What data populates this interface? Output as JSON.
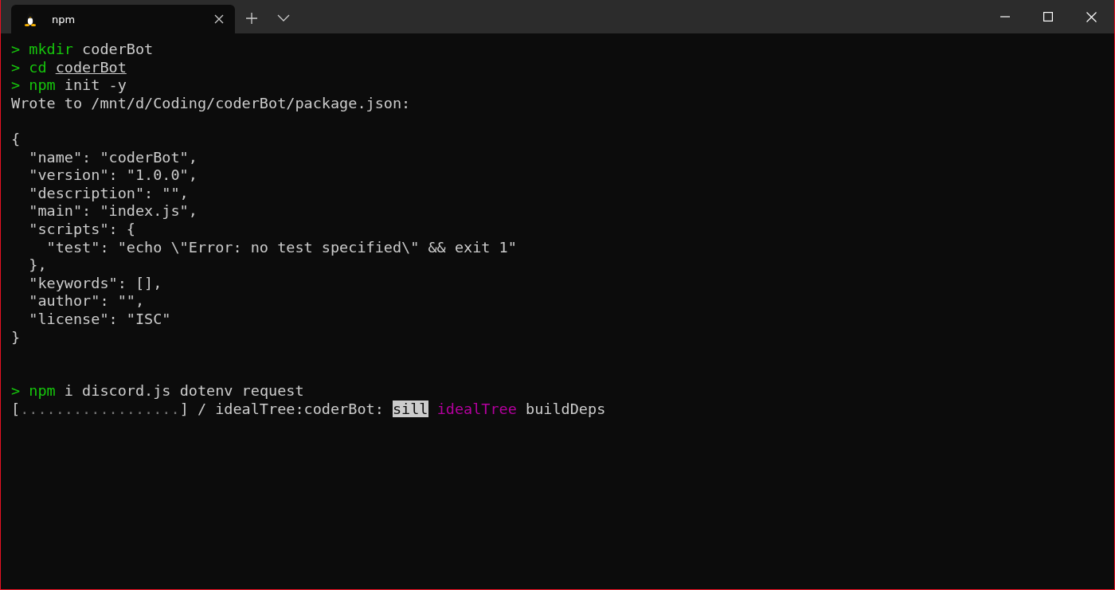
{
  "tab": {
    "title": "npm",
    "selected": true
  },
  "terminal": {
    "lines": [
      {
        "kind": "text",
        "segments": [
          {
            "kind": "prompt",
            "text": ">"
          },
          {
            "kind": "command",
            "text": " mkdir"
          },
          {
            "kind": "plain",
            "text": " coderBot"
          }
        ]
      },
      {
        "kind": "text",
        "segments": [
          {
            "kind": "prompt",
            "text": ">"
          },
          {
            "kind": "command",
            "text": " cd "
          },
          {
            "kind": "underline",
            "text": "coderBot"
          }
        ]
      },
      {
        "kind": "text",
        "segments": [
          {
            "kind": "prompt",
            "text": ">"
          },
          {
            "kind": "command",
            "text": " npm"
          },
          {
            "kind": "plain",
            "text": " init -y"
          }
        ]
      },
      {
        "kind": "text",
        "segments": [
          {
            "kind": "plain",
            "text": "Wrote to /mnt/d/Coding/coderBot/package.json:"
          }
        ]
      },
      {
        "kind": "blank"
      },
      {
        "kind": "text",
        "segments": [
          {
            "kind": "plain",
            "text": "{"
          }
        ]
      },
      {
        "kind": "text",
        "segments": [
          {
            "kind": "plain",
            "text": "  \"name\": \"coderBot\","
          }
        ]
      },
      {
        "kind": "text",
        "segments": [
          {
            "kind": "plain",
            "text": "  \"version\": \"1.0.0\","
          }
        ]
      },
      {
        "kind": "text",
        "segments": [
          {
            "kind": "plain",
            "text": "  \"description\": \"\","
          }
        ]
      },
      {
        "kind": "text",
        "segments": [
          {
            "kind": "plain",
            "text": "  \"main\": \"index.js\","
          }
        ]
      },
      {
        "kind": "text",
        "segments": [
          {
            "kind": "plain",
            "text": "  \"scripts\": {"
          }
        ]
      },
      {
        "kind": "text",
        "segments": [
          {
            "kind": "plain",
            "text": "    \"test\": \"echo \\\"Error: no test specified\\\" && exit 1\""
          }
        ]
      },
      {
        "kind": "text",
        "segments": [
          {
            "kind": "plain",
            "text": "  },"
          }
        ]
      },
      {
        "kind": "text",
        "segments": [
          {
            "kind": "plain",
            "text": "  \"keywords\": [],"
          }
        ]
      },
      {
        "kind": "text",
        "segments": [
          {
            "kind": "plain",
            "text": "  \"author\": \"\","
          }
        ]
      },
      {
        "kind": "text",
        "segments": [
          {
            "kind": "plain",
            "text": "  \"license\": \"ISC\""
          }
        ]
      },
      {
        "kind": "text",
        "segments": [
          {
            "kind": "plain",
            "text": "}"
          }
        ]
      },
      {
        "kind": "blank"
      },
      {
        "kind": "blank"
      },
      {
        "kind": "text",
        "segments": [
          {
            "kind": "prompt",
            "text": ">"
          },
          {
            "kind": "command",
            "text": " npm"
          },
          {
            "kind": "plain",
            "text": " i discord.js dotenv request"
          }
        ]
      },
      {
        "kind": "text",
        "segments": [
          {
            "kind": "plain",
            "text": "["
          },
          {
            "kind": "dim",
            "text": ".................."
          },
          {
            "kind": "plain",
            "text": "] / idealTree:coderBot: "
          },
          {
            "kind": "highlight",
            "text": "sill"
          },
          {
            "kind": "magenta",
            "text": " idealTree"
          },
          {
            "kind": "plain",
            "text": " buildDeps"
          }
        ]
      }
    ]
  }
}
